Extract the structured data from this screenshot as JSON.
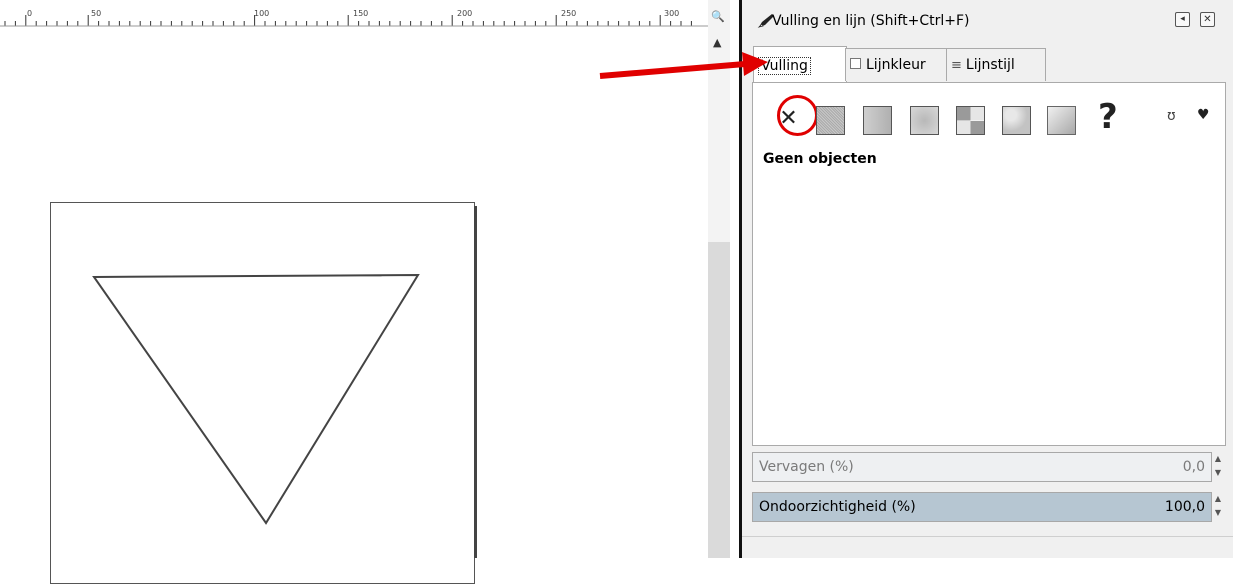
{
  "ruler": {
    "labels": [
      "0",
      "50",
      "100",
      "150",
      "200",
      "250",
      "300"
    ]
  },
  "dialog": {
    "title": "Vulling en lijn (Shift+Ctrl+F)",
    "tabs": [
      {
        "label": "Vulling",
        "active": true
      },
      {
        "label": "Lijnkleur",
        "active": false
      },
      {
        "label": "Lijnstijl",
        "active": false
      }
    ],
    "fill_types": [
      {
        "icon": "no-paint-icon",
        "glyph": "✕",
        "selected": true
      },
      {
        "icon": "flat-color-icon"
      },
      {
        "icon": "linear-gradient-icon"
      },
      {
        "icon": "radial-gradient-icon"
      },
      {
        "icon": "pattern-icon"
      },
      {
        "icon": "swatch-icon"
      },
      {
        "icon": "mesh-gradient-icon"
      },
      {
        "icon": "unset-paint-icon",
        "glyph": "?"
      }
    ],
    "fill_rules": {
      "evenodd_glyph": "ʊ",
      "nonzero_glyph": "♥"
    },
    "status_text": "Geen objecten",
    "blur": {
      "label": "Vervagen (%)",
      "value": "0,0"
    },
    "opacity": {
      "label": "Ondoorzichtigheid (%)",
      "value": "100,0",
      "level": 1.0
    }
  },
  "colors": {
    "annotation_red": "#e00000",
    "opacity_bar": "#b6c6d2"
  }
}
